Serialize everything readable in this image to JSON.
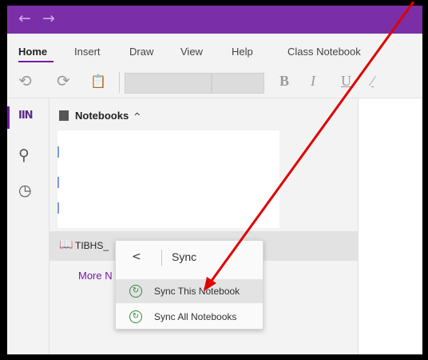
{
  "titlebar": {
    "back_glyph": "←",
    "forward_glyph": "→"
  },
  "tabs": [
    {
      "label": "Home",
      "active": true
    },
    {
      "label": "Insert"
    },
    {
      "label": "Draw"
    },
    {
      "label": "View"
    },
    {
      "label": "Help"
    },
    {
      "label": "Class Notebook"
    }
  ],
  "ribbon": {
    "undo_glyph": "⟲",
    "redo_glyph": "⟳",
    "clipboard_glyph": "📋",
    "bold": "B",
    "italic": "I",
    "underline": "U",
    "highlighter_glyph": "⁄"
  },
  "rail": {
    "notebooks_glyph": "IIN",
    "search_glyph": "⚲",
    "recent_glyph": "◷"
  },
  "notebooks": {
    "header": "Notebooks",
    "caret": "^",
    "row_icon": "📖",
    "row_label": "TIBHS_",
    "more_link": "More N"
  },
  "sync_menu": {
    "back_glyph": "<",
    "title": "Sync",
    "items": [
      {
        "label": "Sync This Notebook",
        "highlighted": true
      },
      {
        "label": "Sync All Notebooks"
      }
    ],
    "icon_glyph": "↻"
  },
  "colors": {
    "accent": "#7719aa",
    "titlebar": "#7a2fa8",
    "sync_icon": "#2e8b3e",
    "annotation_arrow": "#e00000"
  }
}
